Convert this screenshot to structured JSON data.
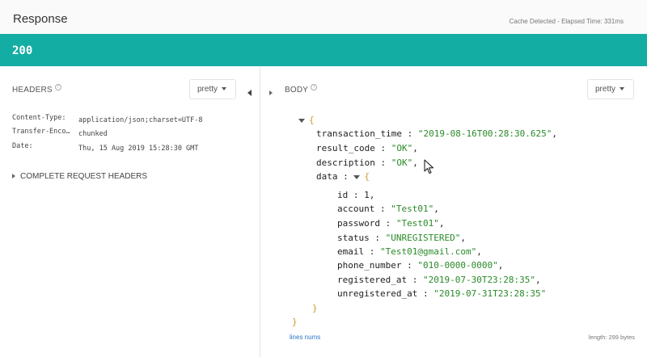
{
  "header": {
    "title": "Response",
    "cache_text": "Cache Detected - Elapsed Time: 331ms"
  },
  "status": {
    "code": "200",
    "color": "#14ada4"
  },
  "headers_panel": {
    "label": "HEADERS",
    "format_select": "pretty",
    "rows": [
      {
        "key": "Content-Type:",
        "value": "application/json;charset=UTF-8"
      },
      {
        "key": "Transfer-Enco…",
        "value": "chunked"
      },
      {
        "key": "Date:",
        "value": "Thu, 15 Aug 2019 15:28:30 GMT"
      }
    ],
    "complete_request_headers": "COMPLETE REQUEST HEADERS"
  },
  "body_panel": {
    "label": "BODY",
    "format_select": "pretty",
    "json": {
      "open_brace": "{",
      "close_brace": "}",
      "transaction_time": {
        "key": "transaction_time",
        "value": "\"2019-08-16T00:28:30.625\""
      },
      "result_code": {
        "key": "result_code",
        "value": "\"OK\""
      },
      "description": {
        "key": "description",
        "value": "\"OK\""
      },
      "data_key": "data",
      "data_open": "{",
      "data_close": "}",
      "data_items": [
        {
          "key": "id",
          "value": "1",
          "type": "num"
        },
        {
          "key": "account",
          "value": "\"Test01\"",
          "type": "str"
        },
        {
          "key": "password",
          "value": "\"Test01\"",
          "type": "str"
        },
        {
          "key": "status",
          "value": "\"UNREGISTERED\"",
          "type": "str"
        },
        {
          "key": "email",
          "value": "\"Test01@gmail.com\"",
          "type": "str"
        },
        {
          "key": "phone_number",
          "value": "\"010-0000-0000\"",
          "type": "str"
        },
        {
          "key": "registered_at",
          "value": "\"2019-07-30T23:28:35\"",
          "type": "str"
        },
        {
          "key": "unregistered_at",
          "value": "\"2019-07-31T23:28:35\"",
          "type": "str"
        }
      ]
    },
    "lines_nums": "lines nums",
    "length": "length: 299 bytes"
  },
  "icons": {
    "help": "help-icon",
    "collapse_panel": "collapse-left-icon",
    "expand_body": "expand-right-icon",
    "json_toggle": "caret-down-icon",
    "cursor": "mouse-cursor-icon"
  }
}
